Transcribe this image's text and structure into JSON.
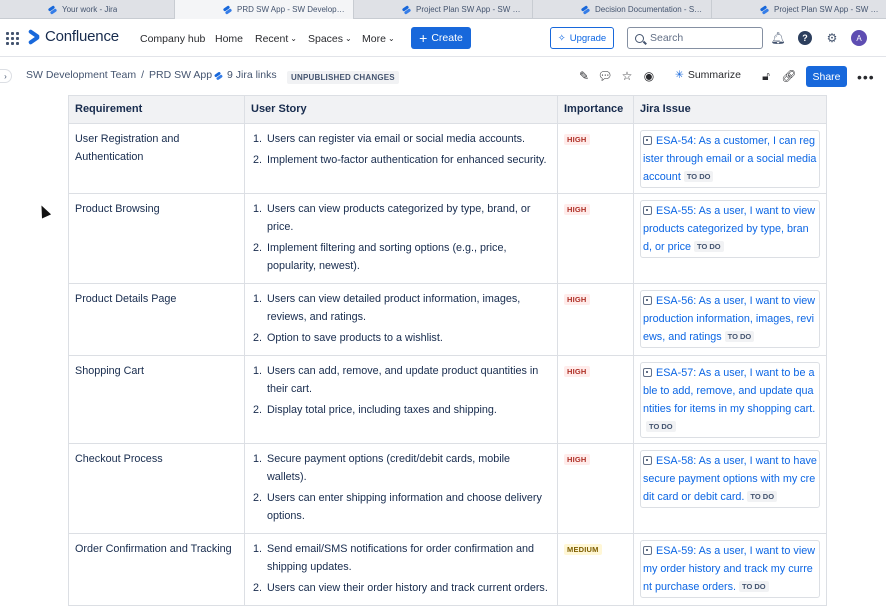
{
  "browser": {
    "tabs": [
      {
        "title": "Your work - Jira",
        "active": false
      },
      {
        "title": "PRD SW App - SW Development Tea...",
        "active": true
      },
      {
        "title": "Project Plan SW App - SW Developm...",
        "active": false
      },
      {
        "title": "Decision Documentation - SW Devel...",
        "active": false
      },
      {
        "title": "Project Plan SW App - SW Developm...",
        "active": false
      }
    ]
  },
  "header": {
    "logo_text": "Confluence",
    "nav": {
      "company_hub": "Company hub",
      "home": "Home",
      "recent": "Recent",
      "spaces": "Spaces",
      "more": "More"
    },
    "create_label": "Create",
    "upgrade_label": "Upgrade",
    "search_placeholder": "Search",
    "avatar_initial": "A"
  },
  "toolbar": {
    "breadcrumb_space": "SW Development Team",
    "breadcrumb_sep": "/",
    "breadcrumb_page": "PRD SW App",
    "jira_links": "9 Jira links",
    "unpublished": "UNPUBLISHED CHANGES",
    "summarize": "Summarize",
    "share": "Share"
  },
  "table": {
    "headers": {
      "requirement": "Requirement",
      "user_story": "User Story",
      "importance": "Importance",
      "jira_issue": "Jira Issue"
    },
    "rows": [
      {
        "requirement": "User Registration and Authentication",
        "stories": [
          "Users can register via email or social media accounts.",
          "Implement two-factor authentication for enhanced security."
        ],
        "importance": "HIGH",
        "jira_text": "ESA-54: As a customer, I can register through email or a social media account",
        "jira_status": "TO DO"
      },
      {
        "requirement": "Product Browsing",
        "stories": [
          "Users can view products categorized by type, brand, or price.",
          "Implement filtering and sorting options (e.g., price, popularity, newest)."
        ],
        "importance": "HIGH",
        "jira_text": "ESA-55: As a user, I want to view products categorized by type, brand, or price",
        "jira_status": "TO DO"
      },
      {
        "requirement": "Product Details Page",
        "stories": [
          "Users can view detailed product information, images, reviews, and ratings.",
          "Option to save products to a wishlist."
        ],
        "importance": "HIGH",
        "jira_text": "ESA-56: As a user, I want to view production information, images, reviews, and ratings",
        "jira_status": "TO DO"
      },
      {
        "requirement": "Shopping Cart",
        "stories": [
          "Users can add, remove, and update product quantities in their cart.",
          "Display total price, including taxes and shipping."
        ],
        "importance": "HIGH",
        "jira_text": "ESA-57: As a user, I want to be able to add, remove, and update quantities for items in my shopping cart.",
        "jira_status": "TO DO"
      },
      {
        "requirement": "Checkout Process",
        "stories": [
          "Secure payment options (credit/debit cards, mobile wallets).",
          "Users can enter shipping information and choose delivery options."
        ],
        "importance": "HIGH",
        "jira_text": "ESA-58: As a user, I want to have secure payment options with my credit card or debit card.",
        "jira_status": "TO DO"
      },
      {
        "requirement": "Order Confirmation and Tracking",
        "stories": [
          "Send email/SMS notifications for order confirmation and shipping updates.",
          "Users can view their order history and track current orders."
        ],
        "importance": "MEDIUM",
        "jira_text": "ESA-59: As a user, I want to view my order history and track my current purchase orders.",
        "jira_status": "TO DO"
      }
    ]
  },
  "colors": {
    "brand_blue": "#1868db",
    "link_blue": "#0c66e4",
    "high_text": "#ae2e24",
    "high_bg": "#ffeceb",
    "medium_text": "#7f5f01",
    "medium_bg": "#fff7d6"
  },
  "icons": [
    "app-switcher-icon",
    "confluence-logo-icon",
    "plus-icon",
    "sparkle-icon",
    "search-icon",
    "notifications-icon",
    "help-icon",
    "settings-icon",
    "edit-icon",
    "comment-icon",
    "star-icon",
    "watch-icon",
    "restrictions-icon",
    "copy-link-icon",
    "more-icon",
    "jira-issue-icon"
  ]
}
